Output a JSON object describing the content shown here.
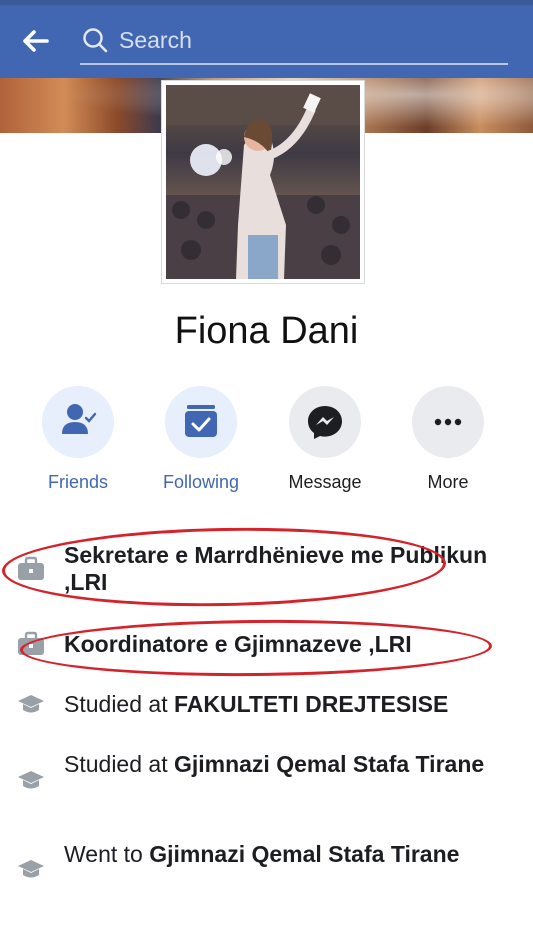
{
  "header": {
    "back_icon": "back-arrow-icon",
    "search_icon": "search-icon",
    "search_placeholder": "Search"
  },
  "profile": {
    "name": "Fiona Dani"
  },
  "actions": [
    {
      "label": "Friends",
      "icon": "friends-icon"
    },
    {
      "label": "Following",
      "icon": "following-icon"
    },
    {
      "label": "Message",
      "icon": "messenger-icon"
    },
    {
      "label": "More",
      "icon": "more-dots-icon"
    }
  ],
  "info": [
    {
      "icon": "briefcase-icon",
      "prefix": "",
      "bold": "Sekretare e Marrdhënieve me Publikun ,LRI"
    },
    {
      "icon": "briefcase-icon",
      "prefix": "",
      "bold": "Koordinatore e Gjimnazeve ,LRI"
    },
    {
      "icon": "graduation-cap-icon",
      "prefix": "Studied at ",
      "bold": "FAKULTETI DREJTESISE"
    },
    {
      "icon": "graduation-cap-icon",
      "prefix": "Studied at ",
      "bold": "Gjimnazi Qemal Stafa Tirane"
    },
    {
      "icon": "graduation-cap-icon",
      "prefix": "Went to ",
      "bold": "Gjimnazi Qemal Stafa Tirane"
    }
  ],
  "colors": {
    "header_blue": "#4267b2",
    "accent_blue": "#4267b2",
    "annotation_red": "#d4232b"
  }
}
